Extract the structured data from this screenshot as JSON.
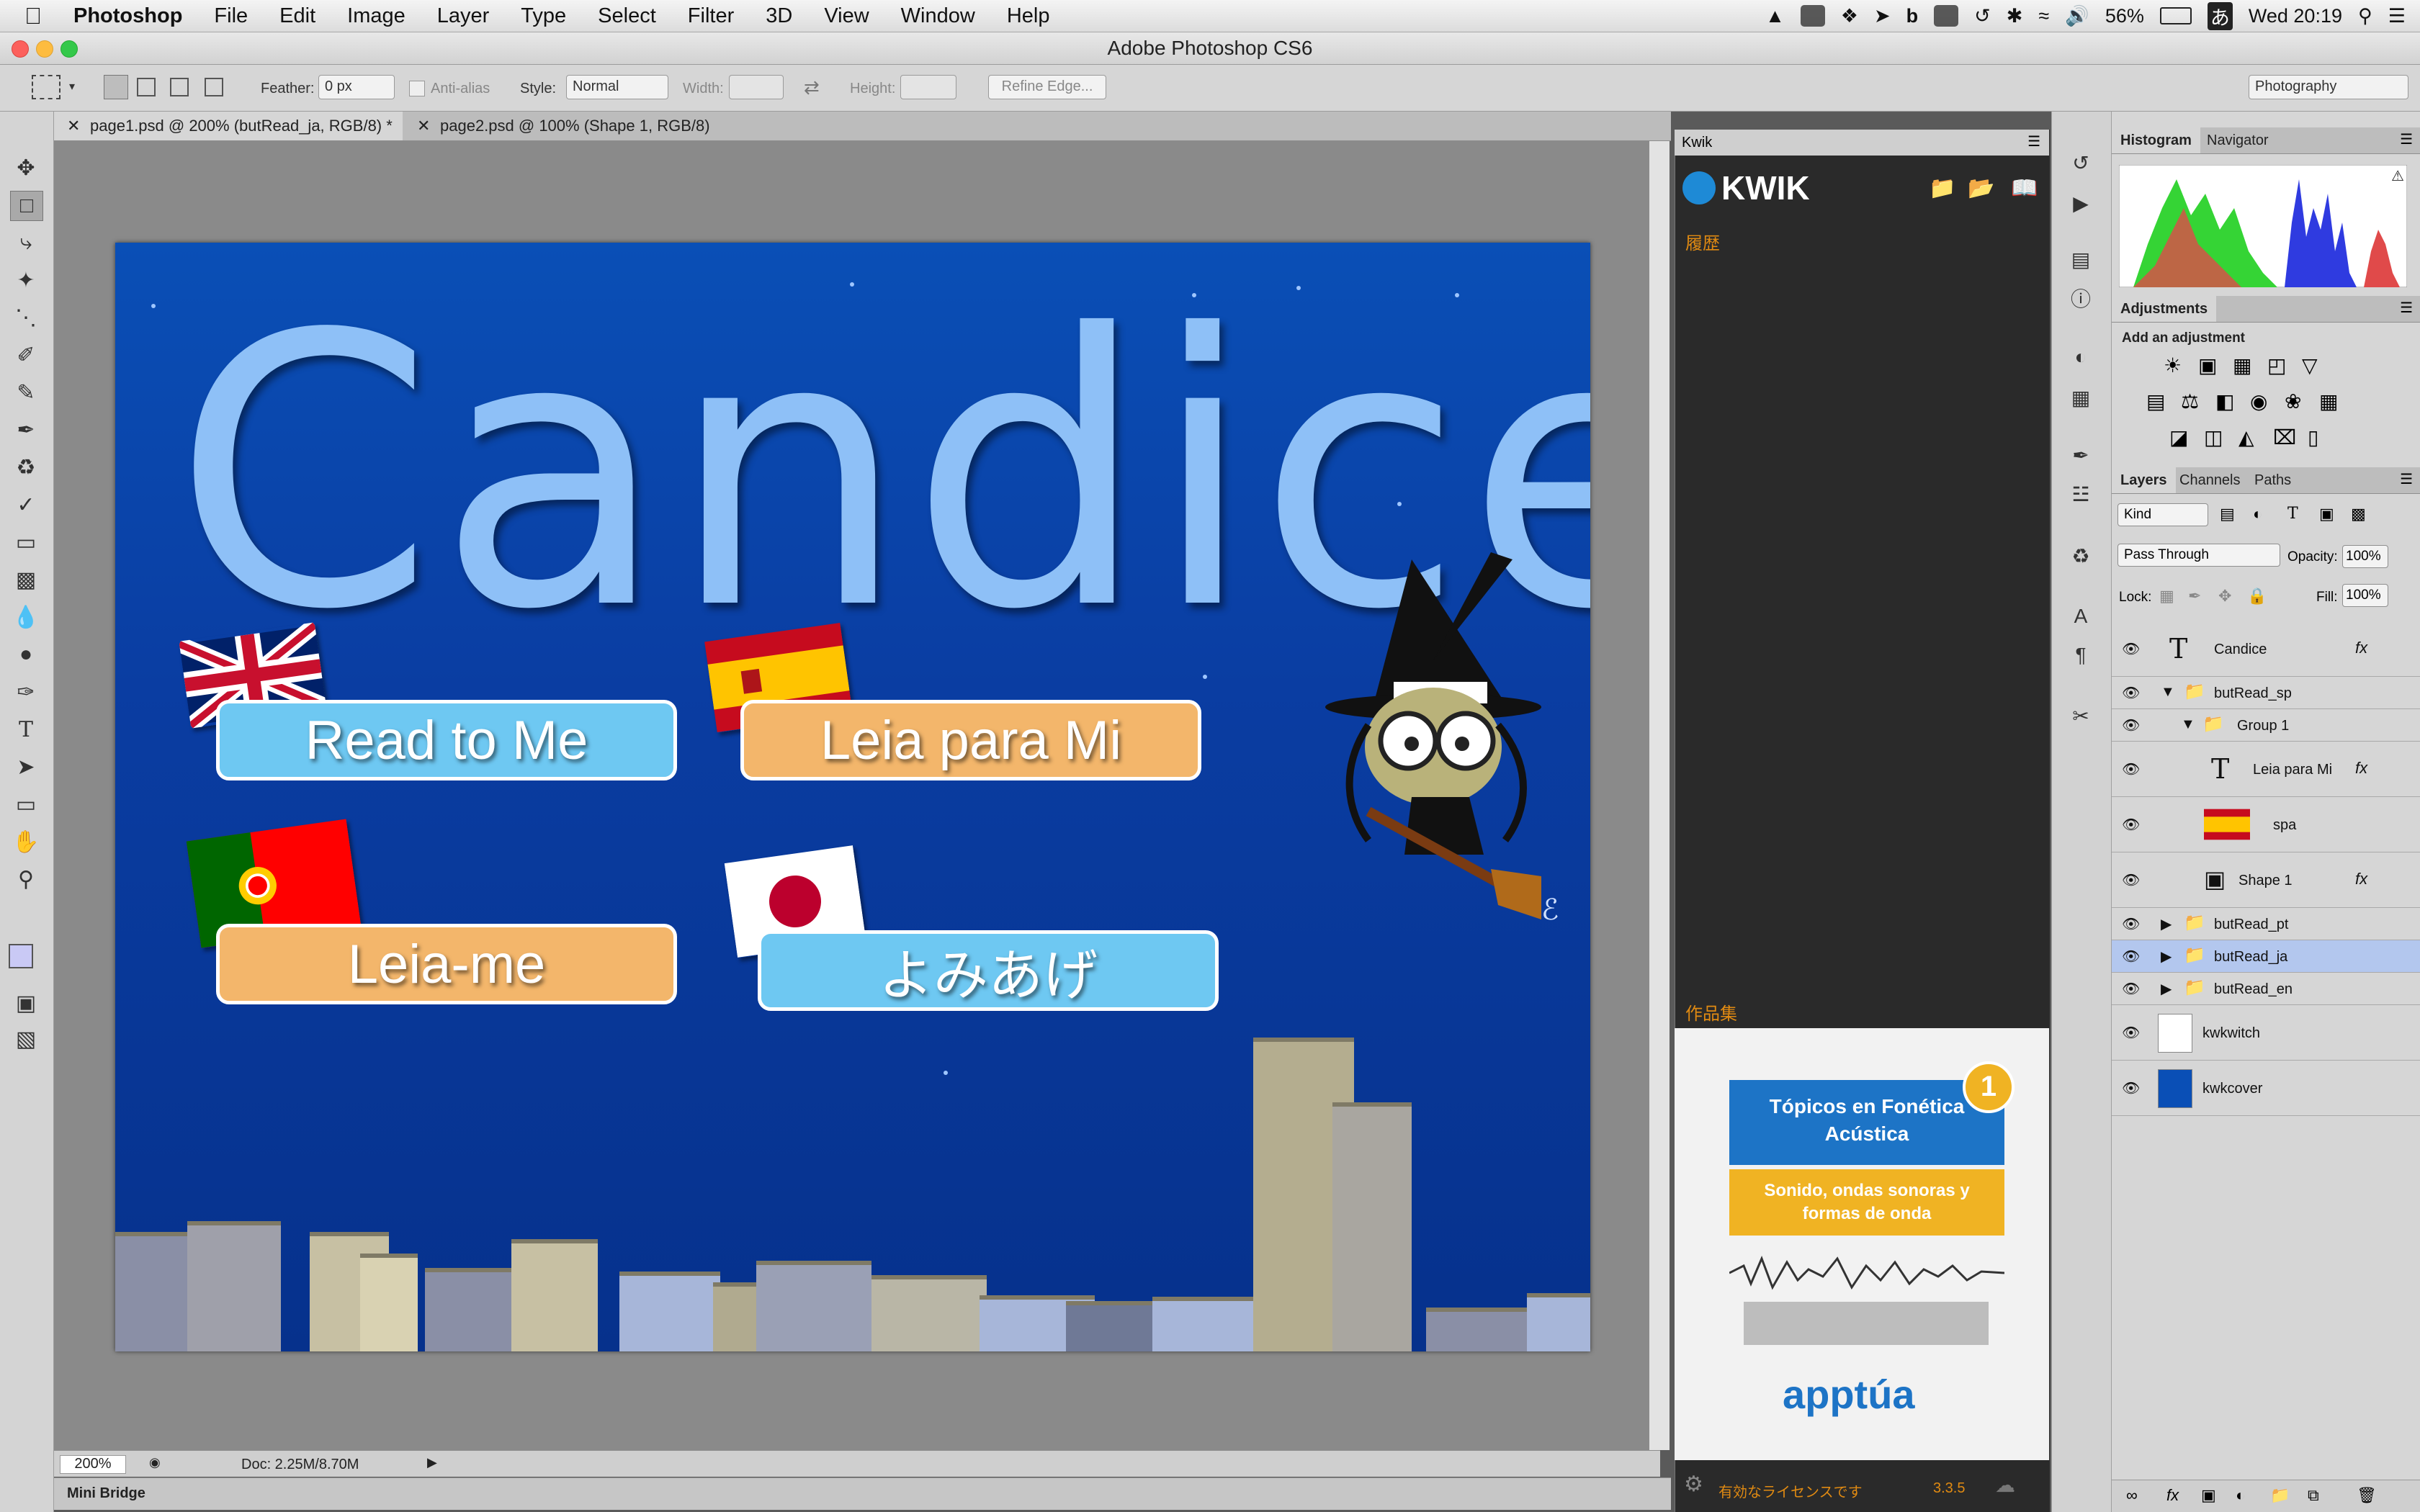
{
  "menubar": {
    "app_name": "Photoshop",
    "items": [
      "File",
      "Edit",
      "Image",
      "Layer",
      "Type",
      "Select",
      "Filter",
      "3D",
      "View",
      "Window",
      "Help"
    ],
    "battery": "56%",
    "ime": "あ",
    "clock": "Wed 20:19"
  },
  "window": {
    "title": "Adobe Photoshop CS6"
  },
  "options": {
    "feather_label": "Feather:",
    "feather_value": "0 px",
    "antialias_label": "Anti-alias",
    "style_label": "Style:",
    "style_value": "Normal",
    "width_label": "Width:",
    "height_label": "Height:",
    "refine_edge": "Refine Edge...",
    "workspace": "Photography"
  },
  "tabs": [
    {
      "label": "page1.psd @ 200% (butRead_ja, RGB/8) *"
    },
    {
      "label": "page2.psd @ 100% (Shape 1, RGB/8)"
    }
  ],
  "document": {
    "title": "Candice",
    "buttons": [
      {
        "label": "Read to Me"
      },
      {
        "label": "Leia para Mi"
      },
      {
        "label": "Leia-me"
      },
      {
        "label": "よみあげ"
      }
    ]
  },
  "status": {
    "zoom": "200%",
    "doc_size": "Doc: 2.25M/8.70M"
  },
  "mini_bridge": "Mini Bridge",
  "kwik": {
    "tab": "Kwik",
    "logo": "KWIK",
    "history_label": "履歴",
    "works_label": "作品集",
    "ad_title": "Tópicos en Fonética Acústica",
    "ad_badge": "1",
    "ad_subtitle": "Sonido, ondas sonoras y formas de onda",
    "ad_brand": "apptúa",
    "footer_license": "有効なライセンスです",
    "version": "3.3.5"
  },
  "histogram": {
    "tabs": [
      "Histogram",
      "Navigator"
    ]
  },
  "adjustments": {
    "tab": "Adjustments",
    "heading": "Add an adjustment"
  },
  "layers": {
    "tabs": [
      "Layers",
      "Channels",
      "Paths"
    ],
    "kind": "Kind",
    "blend_mode": "Pass Through",
    "opacity_label": "Opacity:",
    "opacity_value": "100%",
    "lock_label": "Lock:",
    "fill_label": "Fill:",
    "fill_value": "100%",
    "rows": [
      {
        "name": "Candice"
      },
      {
        "name": "butRead_sp"
      },
      {
        "name": "Group 1"
      },
      {
        "name": "Leia para Mi"
      },
      {
        "name": "spa"
      },
      {
        "name": "Shape 1"
      },
      {
        "name": "butRead_pt"
      },
      {
        "name": "butRead_ja"
      },
      {
        "name": "butRead_en"
      },
      {
        "name": "kwkwitch"
      },
      {
        "name": "kwkcover"
      }
    ],
    "fx": "fx"
  }
}
